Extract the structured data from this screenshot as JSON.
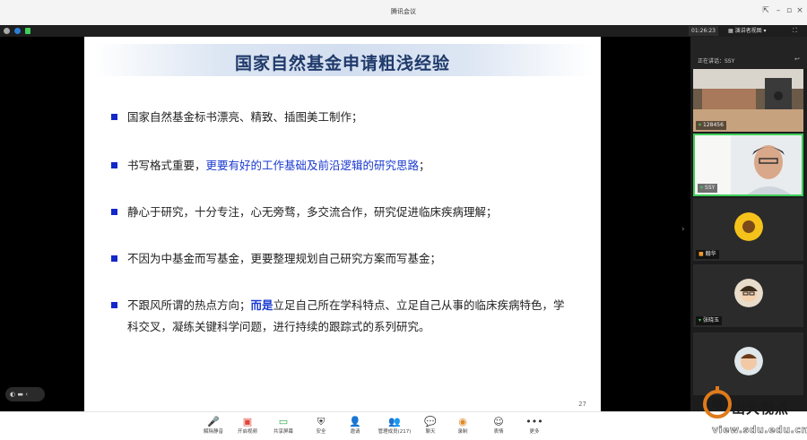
{
  "window": {
    "title": "腾讯会议"
  },
  "infobar": {
    "time": "01:26:23",
    "view_label": "演讲者视图"
  },
  "slide": {
    "title": "国家自然基金申请粗浅经验",
    "bullets": [
      {
        "parts": [
          {
            "text": "国家自然基金标书漂亮、精致、插图美工制作；",
            "style": "normal"
          }
        ]
      },
      {
        "parts": [
          {
            "text": "书写格式重要，",
            "style": "normal"
          },
          {
            "text": "更要有好的工作基础及前沿逻辑的研究思路",
            "style": "hl"
          },
          {
            "text": "；",
            "style": "normal"
          }
        ]
      },
      {
        "parts": [
          {
            "text": "静心于研究，十分专注，心无旁骛，多交流合作，研究促进临床疾病理解；",
            "style": "normal"
          }
        ]
      },
      {
        "parts": [
          {
            "text": "不因为中基金而写基金，更要整理规划自己研究方案而写基金；",
            "style": "normal"
          }
        ]
      },
      {
        "parts": [
          {
            "text": "不跟风所谓的热点方向；",
            "style": "normal"
          },
          {
            "text": "而是",
            "style": "hl-bold"
          },
          {
            "text": "立足自己所在学科特点、立足自己从事的临床疾病特色，学科交叉，凝练关键科学问题，进行持续的跟踪式的系列研究。",
            "style": "normal"
          }
        ]
      }
    ],
    "page_number": "27"
  },
  "panel": {
    "speaking_label": "正在讲话：SSY",
    "tiles": [
      {
        "name": "128456",
        "kind": "room"
      },
      {
        "name": "SSY",
        "kind": "person"
      },
      {
        "name": "翰华",
        "kind": "avatar-sunflower"
      },
      {
        "name": "张晓玉",
        "kind": "avatar-cartoon"
      },
      {
        "name": "",
        "kind": "avatar-cartoon2"
      }
    ]
  },
  "toolbar": {
    "items": [
      {
        "icon": "mic-icon",
        "glyph": "🎤",
        "label": "解除静音"
      },
      {
        "icon": "camera-icon",
        "glyph": "▣",
        "label": "开启视频"
      },
      {
        "icon": "share-screen-icon",
        "glyph": "▭",
        "label": "共享屏幕"
      },
      {
        "icon": "security-icon",
        "glyph": "⛨",
        "label": "安全"
      },
      {
        "icon": "invite-icon",
        "glyph": "👤",
        "label": "邀请"
      },
      {
        "icon": "members-icon",
        "glyph": "👥",
        "label": "管理成员(217)"
      },
      {
        "icon": "chat-icon",
        "glyph": "💬",
        "label": "聊天"
      },
      {
        "icon": "record-icon",
        "glyph": "◉",
        "label": "录制"
      },
      {
        "icon": "emoji-icon",
        "glyph": "☺",
        "label": "表情"
      },
      {
        "icon": "more-icon",
        "glyph": "•••",
        "label": "更多"
      }
    ]
  },
  "watermark": {
    "logo_text": "山大视点",
    "url": "view.sdu.edu.cn"
  },
  "colors": {
    "accent": "#1a3ad0",
    "title": "#1f3a6a",
    "bullet": "#1428c8"
  }
}
